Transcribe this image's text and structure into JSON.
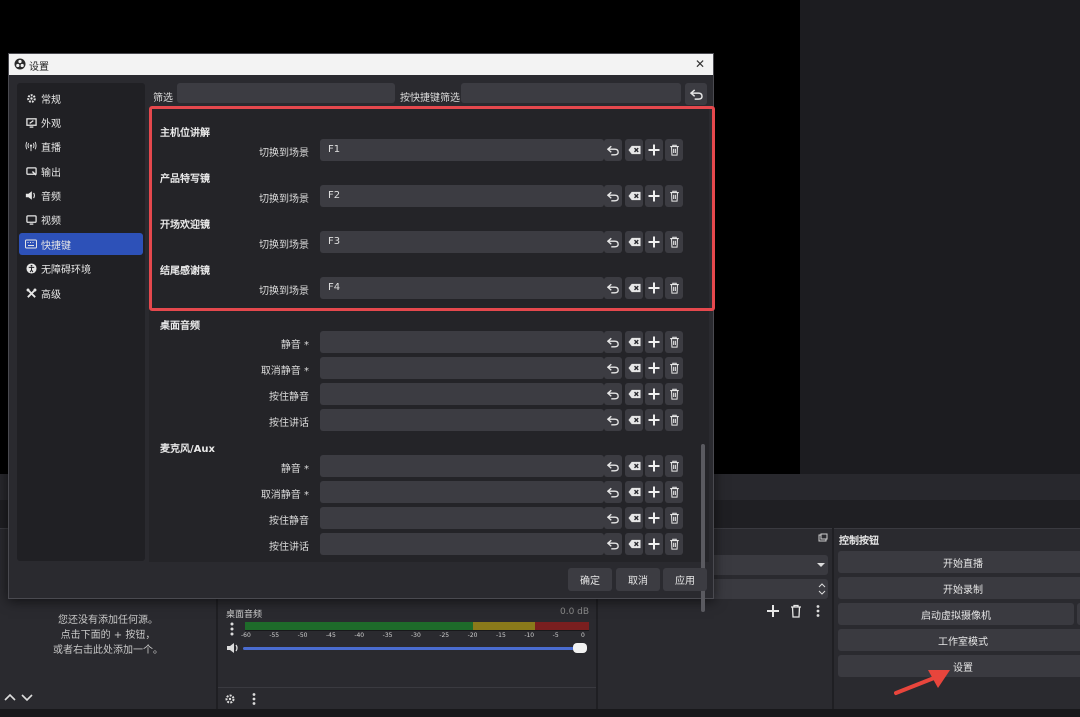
{
  "dialog": {
    "title": "设置",
    "close_symbol": "✕"
  },
  "sidebar": {
    "items": [
      {
        "label": "常规",
        "icon": "gear-icon"
      },
      {
        "label": "外观",
        "icon": "appearance-icon"
      },
      {
        "label": "直播",
        "icon": "broadcast-icon"
      },
      {
        "label": "输出",
        "icon": "output-icon"
      },
      {
        "label": "音频",
        "icon": "speaker-icon"
      },
      {
        "label": "视频",
        "icon": "monitor-icon"
      },
      {
        "label": "快捷键",
        "icon": "keyboard-icon",
        "active": true
      },
      {
        "label": "无障碍环境",
        "icon": "accessibility-icon"
      },
      {
        "label": "高级",
        "icon": "tools-icon"
      }
    ]
  },
  "filter": {
    "label": "筛选",
    "hotkey_label": "按快捷键筛选"
  },
  "hotkey_groups": [
    {
      "title": "主机位讲解",
      "rows": [
        {
          "label": "切换到场景",
          "value": "F1"
        }
      ]
    },
    {
      "title": "产品特写镜",
      "rows": [
        {
          "label": "切换到场景",
          "value": "F2"
        }
      ]
    },
    {
      "title": "开场欢迎镜",
      "rows": [
        {
          "label": "切换到场景",
          "value": "F3"
        }
      ]
    },
    {
      "title": "结尾感谢镜",
      "rows": [
        {
          "label": "切换到场景",
          "value": "F4"
        }
      ]
    },
    {
      "title": "桌面音频",
      "rows": [
        {
          "label": "静音 *",
          "value": ""
        },
        {
          "label": "取消静音 *",
          "value": ""
        },
        {
          "label": "按住静音",
          "value": ""
        },
        {
          "label": "按住讲话",
          "value": ""
        }
      ]
    },
    {
      "title": "麦克风/Aux",
      "rows": [
        {
          "label": "静音 *",
          "value": ""
        },
        {
          "label": "取消静音 *",
          "value": ""
        },
        {
          "label": "按住静音",
          "value": ""
        },
        {
          "label": "按住讲话",
          "value": ""
        }
      ]
    }
  ],
  "dialog_buttons": {
    "ok": "确定",
    "cancel": "取消",
    "apply": "应用"
  },
  "sources_dock": {
    "empty_line1": "您还没有添加任何源。",
    "empty_line2": "点击下面的 + 按钮，",
    "empty_line3": "或者右击此处添加一个。"
  },
  "mixer": {
    "channel_name": "桌面音频",
    "level": "0.0 dB",
    "ticks": [
      "-60",
      "-55",
      "-50",
      "-45",
      "-40",
      "-35",
      "-30",
      "-25",
      "-20",
      "-15",
      "-10",
      "-5",
      "0"
    ],
    "volume_fraction": 1.0
  },
  "controls": {
    "title": "控制按钮",
    "buttons": [
      "开始直播",
      "开始录制",
      "启动虚拟摄像机",
      "工作室模式",
      "设置"
    ]
  },
  "colors": {
    "accent_blue": "#2d51b8",
    "highlight_red": "#e5484d",
    "arrow_red": "#e8453c",
    "meter_green": "#1e6b2a",
    "meter_yellow": "#8a7a1a",
    "meter_red": "#7a1f1f"
  }
}
